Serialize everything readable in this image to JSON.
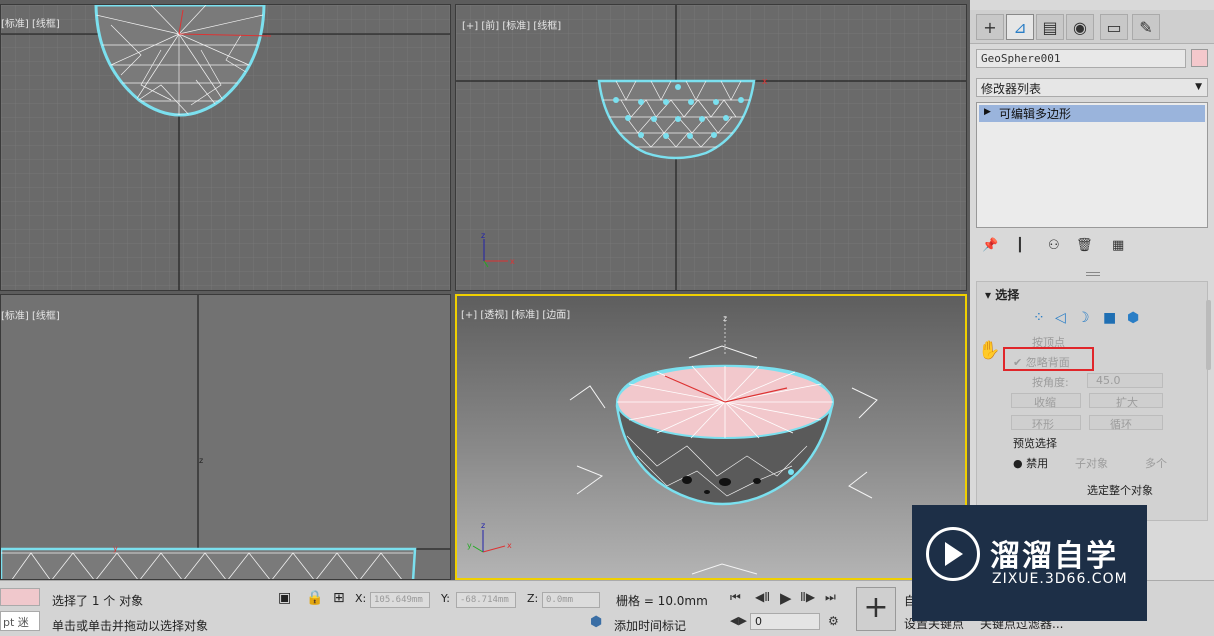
{
  "viewports": {
    "top": {
      "label": "[标准] [线框]"
    },
    "front": {
      "label": "[+] [前] [标准] [线框]"
    },
    "left": {
      "label": "[标准] [线框]"
    },
    "persp": {
      "label": "[+] [透视] [标准] [边面]"
    }
  },
  "axis": {
    "x": "x",
    "y": "y",
    "z": "z"
  },
  "panel": {
    "tabs": [
      {
        "icon": "plus-icon",
        "glyph": "+"
      },
      {
        "icon": "modify-icon",
        "glyph": "⊿"
      },
      {
        "icon": "hierarchy-icon",
        "glyph": "▤"
      },
      {
        "icon": "motion-icon",
        "glyph": "◉"
      },
      {
        "icon": "display-icon",
        "glyph": "▭"
      },
      {
        "icon": "utilities-icon",
        "glyph": "✎"
      }
    ],
    "object_name": "GeoSphere001",
    "object_color": "#f4c8cc",
    "modifier_list": "修改器列表",
    "stack_item": "可编辑多边形",
    "selection": {
      "title": "选择",
      "by_vertex": "按顶点",
      "ignore_backfacing": "忽略背面",
      "by_angle": "按角度:",
      "angle_value": "45.0",
      "shrink": "收缩",
      "grow": "扩大",
      "ring": "环形",
      "loop": "循环",
      "preview": "预览选择",
      "disabled": "禁用",
      "subobject": "子对象",
      "multi": "多个",
      "select_whole": "选定整个对象"
    }
  },
  "status": {
    "selected": "选择了 1 个 对象",
    "hint": "单击或单击并拖动以选择对象",
    "left_field": "pt 迷",
    "x_label": "X:",
    "x_value": "105.649mm",
    "y_label": "Y:",
    "y_value": "-68.714mm",
    "z_label": "Z:",
    "z_value": "0.0mm",
    "grid": "栅格 = 10.0mm",
    "add_time_tag": "添加时间标记",
    "frame": "0",
    "auto_key": "自",
    "set_key": "设置关键点",
    "key_filter": "关键点过滤器..."
  },
  "watermark": {
    "cn": "溜溜自学",
    "en": "ZIXUE.3D66.COM"
  },
  "colors": {
    "wire": "#ffffff",
    "highlight": "#7be0ef",
    "active_border": "#f0d000",
    "accent": "#2a7ec6"
  }
}
